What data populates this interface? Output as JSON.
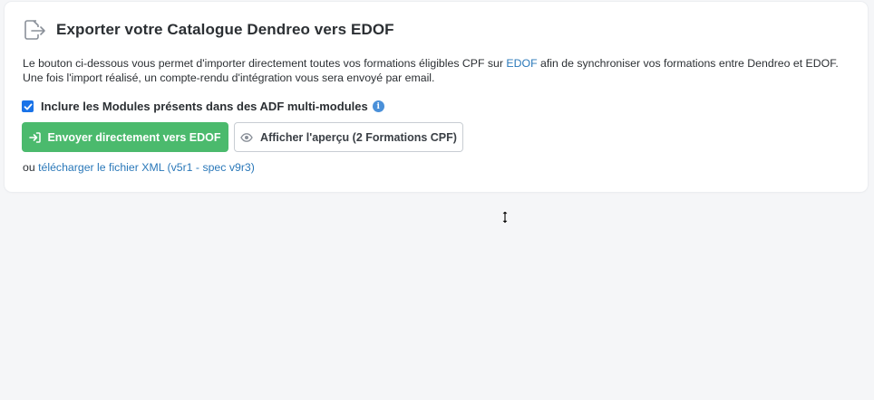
{
  "card": {
    "title": "Exporter votre Catalogue Dendreo vers EDOF",
    "icon": "export-icon",
    "description_before": "Le bouton ci-dessous vous permet d'importer directement toutes vos formations éligibles CPF sur ",
    "description_link": "EDOF",
    "description_after": " afin de synchroniser vos formations entre Dendreo et EDOF. Une fois l'import réalisé, un compte-rendu d'intégration vous sera envoyé par email."
  },
  "include_modules": {
    "checked": true,
    "label": "Inclure les Modules présents dans des ADF multi-modules",
    "info_icon": "info-icon"
  },
  "buttons": {
    "send_label": "Envoyer directement vers EDOF",
    "send_icon": "sign-in-arrow-icon",
    "preview_label": "Afficher l'aperçu (2 Formations CPF)",
    "preview_icon": "eye-icon"
  },
  "download": {
    "prefix": "ou ",
    "link": "télécharger le fichier XML (v5r1 - spec v9r3)"
  },
  "colors": {
    "primary_green": "#4bba6d",
    "link_blue": "#2a78b9",
    "checkbox_blue": "#1a73e8",
    "background": "#f5f6f8"
  }
}
